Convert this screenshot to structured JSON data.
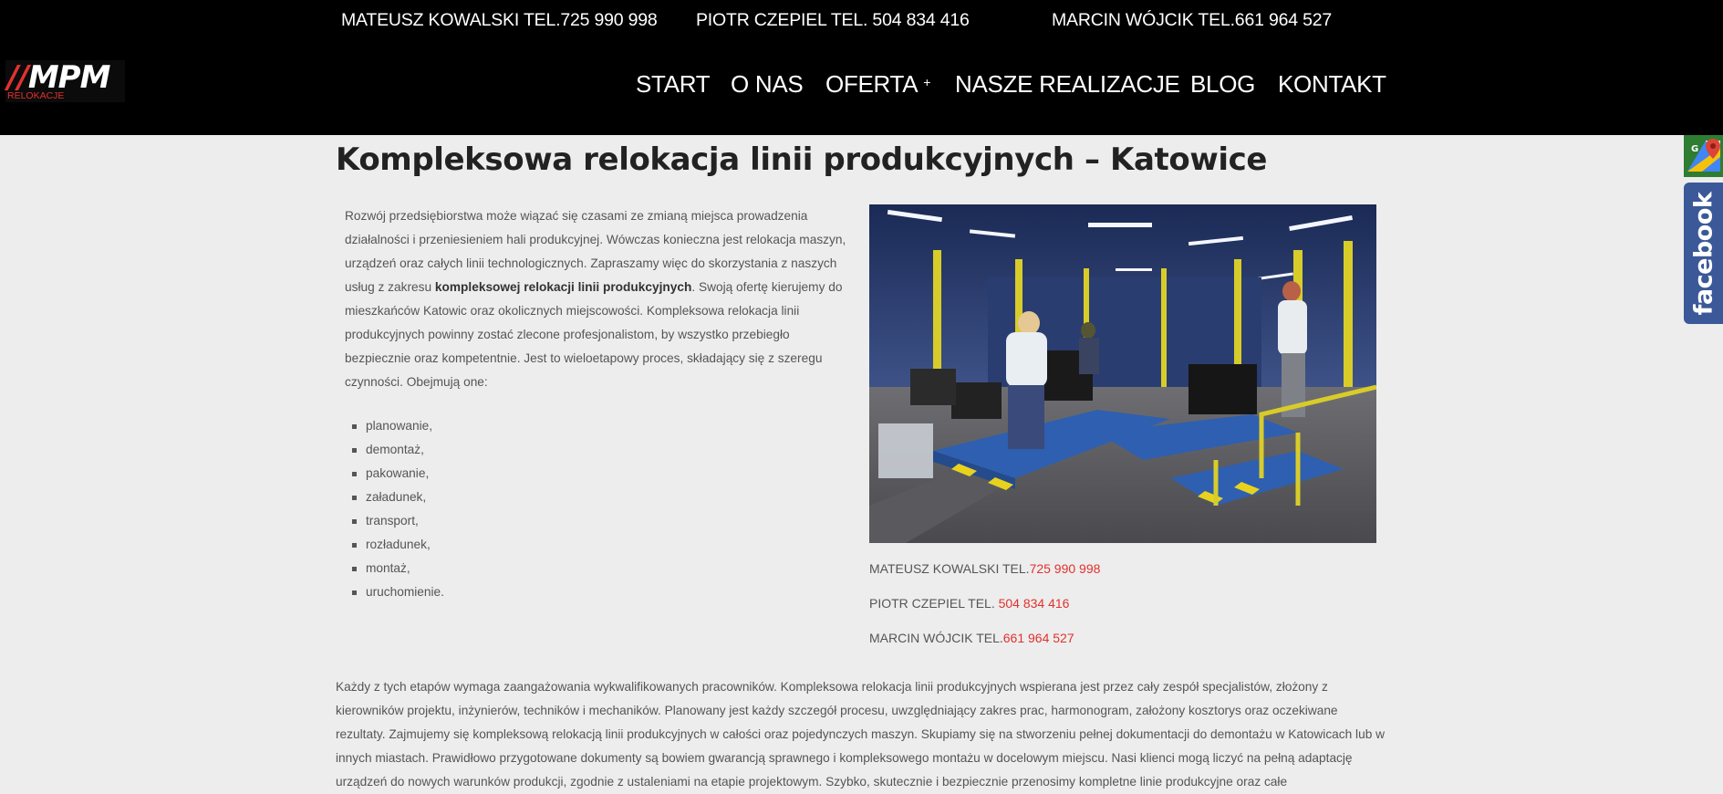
{
  "header": {
    "contacts": [
      "MATEUSZ KOWALSKI TEL.725 990 998",
      "PIOTR CZEPIEL TEL. 504 834 416",
      "MARCIN WÓJCIK TEL.661 964 527"
    ],
    "logo": {
      "mark": "MPM",
      "slashes": "//",
      "subtitle": "RELOKACJE"
    },
    "nav": [
      {
        "label": "START"
      },
      {
        "label": "O NAS"
      },
      {
        "label": "OFERTA",
        "submenu_indicator": "+"
      },
      {
        "label": "NASZE REALIZACJE"
      },
      {
        "label": "BLOG"
      },
      {
        "label": "KONTAKT"
      }
    ]
  },
  "main": {
    "title": "Kompleksowa relokacja linii produkcyjnych – Katowice",
    "intro": {
      "before_bold": "Rozwój przedsiębiorstwa może wiązać się czasami ze zmianą miejsca prowadzenia działalności i przeniesieniem hali produkcyjnej. Wówczas konieczna jest relokacja maszyn, urządzeń oraz całych linii technologicznych. Zapraszamy więc do skorzystania z naszych usług z zakresu ",
      "bold": "kompleksowej relokacji linii produkcyjnych",
      "after_bold": ". Swoją ofertę kierujemy do mieszkańców Katowic oraz okolicznych miejscowości. Kompleksowa relokacja linii produkcyjnych powinny zostać zlecone profesjonalistom, by wszystko przebiegło bezpiecznie oraz kompetentnie. Jest to wieloetapowy proces, składający się z szeregu czynności. Obejmują one:"
    },
    "steps": [
      "planowanie,",
      "demontaż,",
      "pakowanie,",
      "załadunek,",
      "transport,",
      "rozładunek,",
      "montaż,",
      "uruchomienie."
    ],
    "contacts": [
      {
        "name": "MATEUSZ KOWALSKI TEL.",
        "tel": "725 990 998"
      },
      {
        "name": "PIOTR CZEPIEL TEL. ",
        "tel": "504 834 416"
      },
      {
        "name": "MARCIN WÓJCIK TEL.",
        "tel": "661 964 527"
      }
    ],
    "paragraph": "Każdy z tych etapów wymaga zaangażowania wykwalifikowanych pracowników. Kompleksowa relokacja linii produkcyjnych wspierana jest przez cały zespół specjalistów, złożony z kierowników projektu, inżynierów, techników i mechaników. Planowany jest każdy szczegół procesu, uwzględniający zakres prac, harmonogram, założony kosztorys oraz oczekiwane rezultaty. Zajmujemy się kompleksową relokacją linii produkcyjnych w całości oraz pojedynczych maszyn. Skupiamy się na stworzeniu pełnej dokumentacji do demontażu w Katowicach lub w innych miastach. Prawidłowo przygotowane dokumenty są bowiem gwarancją sprawnego i kompleksowego montażu w docelowym miejscu.  Nasi klienci mogą liczyć na pełną adaptację urządzeń do nowych warunków produkcji, zgodnie z ustaleniami na etapie projektowym. Szybko, skutecznie i bezpiecznie przenosimy kompletne linie produkcyjne oraz całe"
  },
  "widgets": {
    "maps_letter": "G",
    "facebook_label": "facebook"
  },
  "colors": {
    "header_bg": "#000000",
    "page_bg": "#ededed",
    "accent_red": "#e0322f",
    "facebook_blue": "#3b5998"
  },
  "icons": [
    "google-maps-icon",
    "facebook-icon"
  ]
}
